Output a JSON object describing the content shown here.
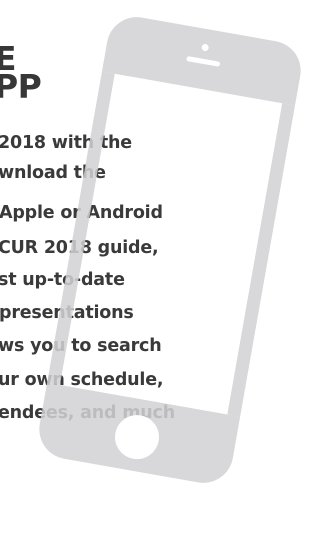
{
  "heading": {
    "line1": "E",
    "line2": "PP"
  },
  "body_lines": [
    "2018 with the",
    "wnload the",
    "Apple or Android",
    "CUR 2018 guide,",
    "st up-to-date",
    "presentations",
    "ws you to search",
    "ur own schedule,",
    "endees, and much"
  ],
  "colors": {
    "text": "#3a3a3a",
    "phone": "#d2d2d4",
    "background": "#ffffff"
  },
  "icons": {
    "phone": "smartphone-icon"
  }
}
